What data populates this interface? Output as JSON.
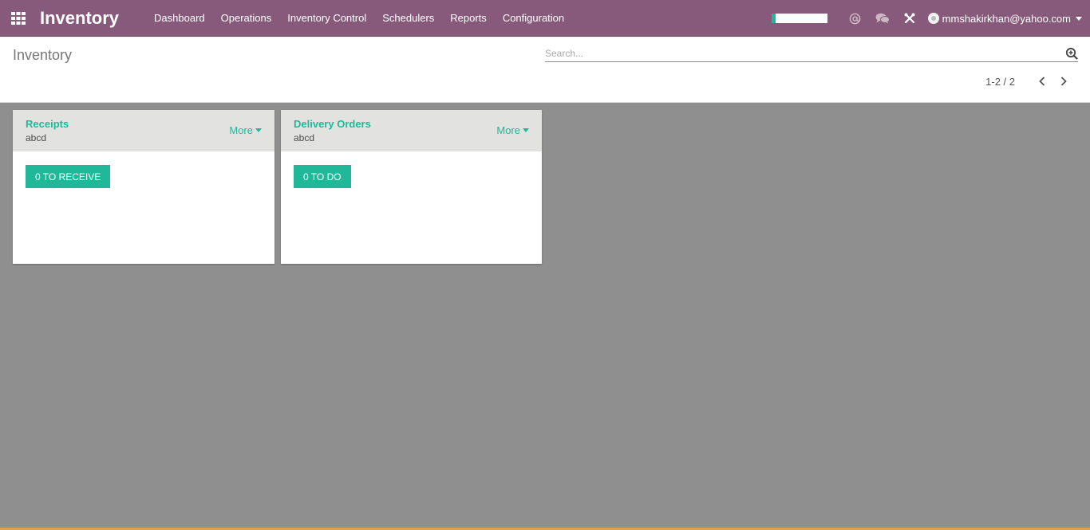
{
  "app": {
    "brand": "Inventory"
  },
  "menu": [
    {
      "label": "Dashboard"
    },
    {
      "label": "Operations"
    },
    {
      "label": "Inventory Control"
    },
    {
      "label": "Schedulers"
    },
    {
      "label": "Reports"
    },
    {
      "label": "Configuration"
    }
  ],
  "user": {
    "email": "mmshakirkhan@yahoo.com"
  },
  "icons": {
    "apps": "apps-grid-icon",
    "mentions": "at-icon",
    "messages": "chat-bubbles-icon",
    "debug": "tools-icon",
    "search": "search-plus-icon",
    "prev": "chevron-left-icon",
    "next": "chevron-right-icon"
  },
  "control_panel": {
    "title": "Inventory",
    "search_placeholder": "Search...",
    "pager": "1-2 / 2"
  },
  "cards": [
    {
      "title": "Receipts",
      "subtitle": "abcd",
      "more": "More",
      "action": "0 TO RECEIVE"
    },
    {
      "title": "Delivery Orders",
      "subtitle": "abcd",
      "more": "More",
      "action": "0 TO DO"
    }
  ],
  "colors": {
    "navbar": "#875a7b",
    "accent": "#21b799",
    "background": "#8f8f8f"
  }
}
